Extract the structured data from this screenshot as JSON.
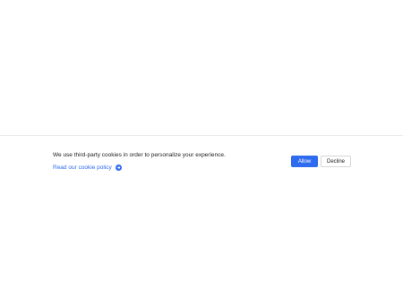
{
  "cookie_banner": {
    "message": "We use third-party cookies in order to personalize your experience.",
    "policy_link": "Read our cookie policy",
    "allow_label": "Allow",
    "decline_label": "Decline",
    "icons": {
      "policy_link_icon": "arrow-right-circle-icon"
    },
    "colors": {
      "accent": "#2f6bef",
      "text": "#1c1c1c"
    }
  }
}
